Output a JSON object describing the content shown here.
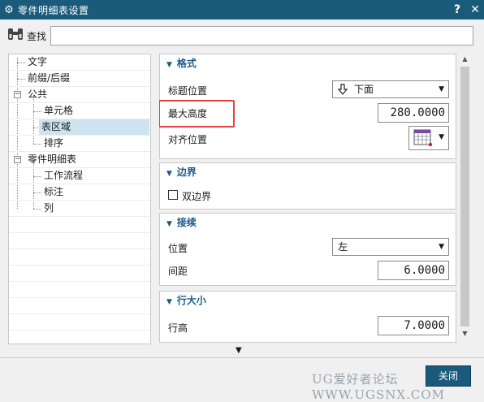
{
  "window": {
    "title": "零件明细表设置",
    "help_label": "?",
    "close_label": "✕"
  },
  "search": {
    "label": "查找",
    "value": "",
    "placeholder": ""
  },
  "tree": {
    "items": [
      {
        "label": "文字"
      },
      {
        "label": "前缀/后缀"
      },
      {
        "label": "公共",
        "expander": "−"
      },
      {
        "label": "单元格"
      },
      {
        "label": "表区域"
      },
      {
        "label": "排序"
      },
      {
        "label": "零件明细表",
        "expander": "−"
      },
      {
        "label": "工作流程"
      },
      {
        "label": "标注"
      },
      {
        "label": "列"
      }
    ],
    "selected_index": 4
  },
  "sections": {
    "format": {
      "title": "格式",
      "title_pos_label": "标题位置",
      "title_pos_value": "下面",
      "max_height_label": "最大高度",
      "max_height_value": "280.0000",
      "align_label": "对齐位置"
    },
    "border": {
      "title": "边界",
      "double_border_label": "双边界",
      "double_border_checked": false
    },
    "join": {
      "title": "接续",
      "position_label": "位置",
      "position_value": "左",
      "spacing_label": "间距",
      "spacing_value": "6.0000"
    },
    "row_size": {
      "title": "行大小",
      "row_height_label": "行高",
      "row_height_value": "7.0000"
    }
  },
  "footer": {
    "close_label": "关闭"
  },
  "watermark": "UG爱好者论坛 WWW.UGSNX.COM",
  "colors": {
    "titlebar": "#1a5a7a",
    "section_title": "#1a5a8a",
    "highlight": "#e84040",
    "selected": "#cce4ef"
  }
}
